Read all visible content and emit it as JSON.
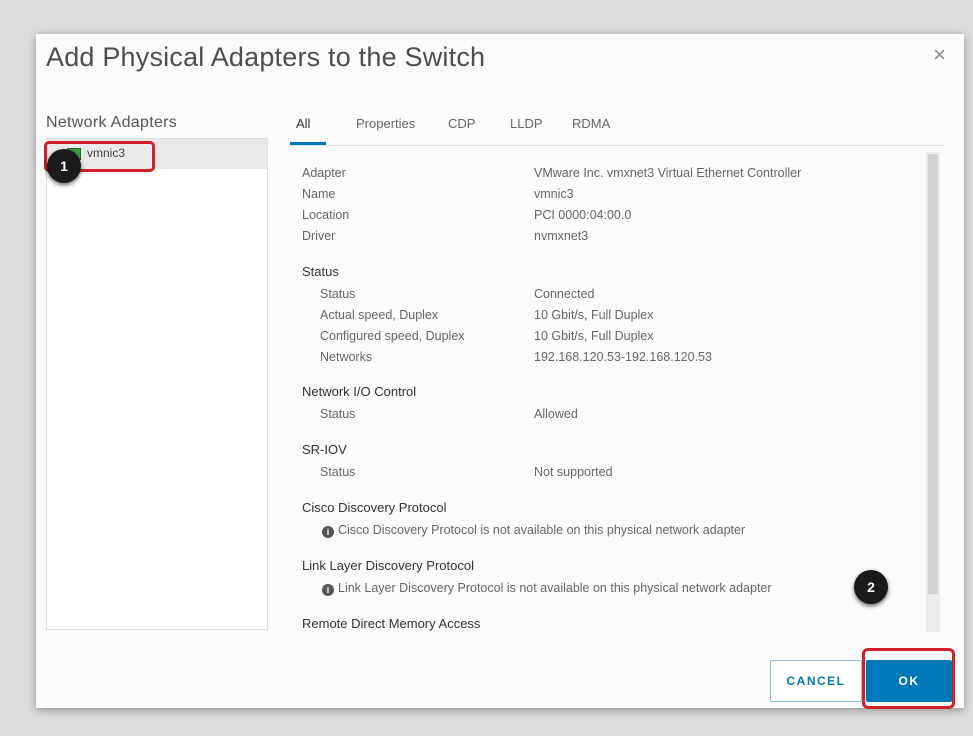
{
  "dialog": {
    "title": "Add Physical Adapters to the Switch",
    "close_glyph": "×"
  },
  "left": {
    "label": "Network Adapters",
    "items": [
      {
        "label": "vmnic3",
        "icon": "network-adapter-icon"
      }
    ]
  },
  "tabs": [
    "All",
    "Properties",
    "CDP",
    "LLDP",
    "RDMA"
  ],
  "details": {
    "rows": [
      {
        "k": "Adapter",
        "v": "VMware Inc. vmxnet3 Virtual Ethernet Controller"
      },
      {
        "k": "Name",
        "v": "vmnic3"
      },
      {
        "k": "Location",
        "v": "PCI 0000:04:00.0"
      },
      {
        "k": "Driver",
        "v": "nvmxnet3"
      }
    ],
    "status": {
      "heading": "Status",
      "rows": [
        {
          "k": "Status",
          "v": "Connected"
        },
        {
          "k": "Actual speed, Duplex",
          "v": "10 Gbit/s, Full Duplex"
        },
        {
          "k": "Configured speed, Duplex",
          "v": "10 Gbit/s, Full Duplex"
        },
        {
          "k": "Networks",
          "v": "192.168.120.53-192.168.120.53"
        }
      ]
    },
    "nioc": {
      "heading": "Network I/O Control",
      "k": "Status",
      "v": "Allowed"
    },
    "sriov": {
      "heading": "SR-IOV",
      "k": "Status",
      "v": "Not supported"
    },
    "cdp": {
      "heading": "Cisco Discovery Protocol",
      "note": "Cisco Discovery Protocol is not available on this physical network adapter"
    },
    "lldp": {
      "heading": "Link Layer Discovery Protocol",
      "note": "Link Layer Discovery Protocol is not available on this physical network adapter"
    },
    "rdma": {
      "heading": "Remote Direct Memory Access"
    }
  },
  "buttons": {
    "cancel": "CANCEL",
    "ok": "OK"
  },
  "callouts": {
    "one": "1",
    "two": "2"
  },
  "colors": {
    "accent": "#0079b8",
    "highlight": "#d0202a"
  }
}
